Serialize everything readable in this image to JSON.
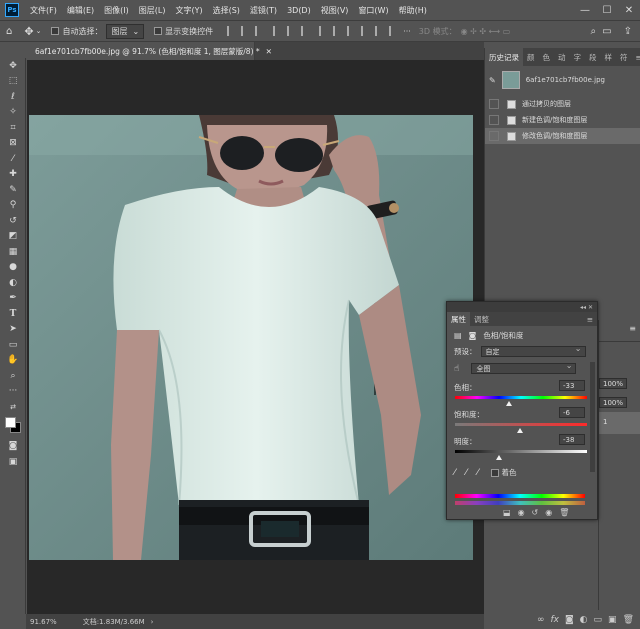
{
  "app": {
    "logo_text": "Ps"
  },
  "menu": [
    "文件(F)",
    "编辑(E)",
    "图像(I)",
    "图层(L)",
    "文字(Y)",
    "选择(S)",
    "滤镜(T)",
    "3D(D)",
    "视图(V)",
    "窗口(W)",
    "帮助(H)"
  ],
  "window_controls": [
    "—",
    "☐",
    "✕"
  ],
  "options_bar": {
    "auto_select_label": "自动选择：",
    "auto_select_value": "图层",
    "show_transform_label": "显示变换控件",
    "mode_3d_label": "3D 模式："
  },
  "document": {
    "tab_title": "6af1e701cb7fb00e.jpg @ 91.7% (色相/饱和度 1, 图层蒙版/8) *",
    "zoom": "91.67%",
    "doc_info": "文档:1.83M/3.66M"
  },
  "history_panel": {
    "tabs": [
      "历史记录",
      "颜",
      "色",
      "动",
      "字",
      "段",
      "样",
      "符"
    ],
    "snapshot_name": "6af1e701cb7fb00e.jpg",
    "steps": [
      {
        "label": "通过拷贝的图层",
        "selected": false
      },
      {
        "label": "新建色调/饱和度图层",
        "selected": false
      },
      {
        "label": "修改色调/饱和度图层",
        "selected": true
      }
    ]
  },
  "layers_edge": {
    "opacity_1": "100%",
    "opacity_2": "100%",
    "layer_num": "1"
  },
  "properties": {
    "tabs": [
      "属性",
      "调整"
    ],
    "title": "色相/饱和度",
    "preset_label": "预设：",
    "preset_value": "自定",
    "channel_value": "全图",
    "hue_label": "色相：",
    "hue_value": "-33",
    "sat_label": "饱和度：",
    "sat_value": "-6",
    "light_label": "明度：",
    "light_value": "-38",
    "colorize_label": "着色",
    "hue_fraction": 0.41,
    "sat_fraction": 0.49,
    "light_fraction": 0.33
  },
  "colors": {
    "panel": "#535353",
    "dark": "#424242",
    "canvas": "#282828",
    "accent": "#31a8ff"
  }
}
